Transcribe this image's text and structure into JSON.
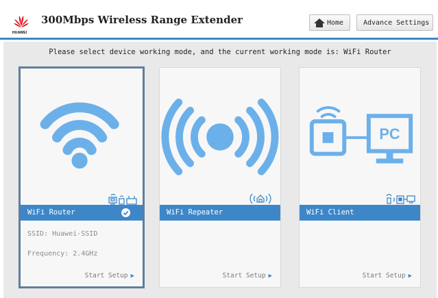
{
  "header": {
    "brand": "HUAWEI",
    "title": "300Mbps Wireless Range Extender",
    "home_label": "Home",
    "advance_label": "Advance Settings"
  },
  "main": {
    "instruction": "Please select device working mode, and the current working mode is: WiFi Router",
    "modes": [
      {
        "label": "WiFi Router",
        "selected": true,
        "ssid": "SSID: Huawei-SSID",
        "frequency": "Frequency: 2.4GHz",
        "setup": "Start Setup"
      },
      {
        "label": "WiFi Repeater",
        "selected": false,
        "setup": "Start Setup"
      },
      {
        "label": "WiFi Client",
        "selected": false,
        "setup": "Start Setup"
      }
    ]
  },
  "colors": {
    "accent": "#3d87c9",
    "brand_red": "#e0141e",
    "icon_light": "#6cb0ea"
  },
  "icons": [
    "huawei-logo",
    "home-icon",
    "gear-icon",
    "wifi-icon",
    "signal-waves-icon",
    "pc-client-icon",
    "check-icon",
    "play-triangle-icon"
  ]
}
